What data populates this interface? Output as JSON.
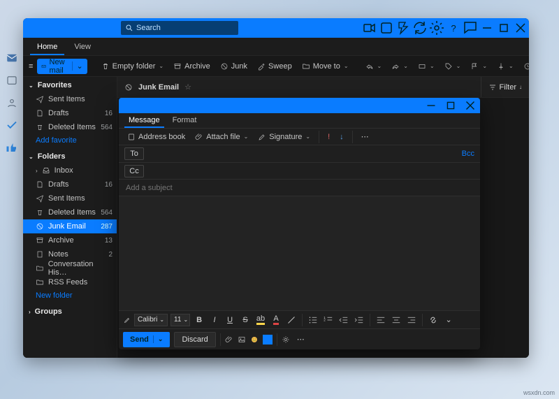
{
  "search": {
    "placeholder": "Search"
  },
  "tabs": {
    "home": "Home",
    "view": "View"
  },
  "toolbar": {
    "newmail": "New mail",
    "emptyfolder": "Empty folder",
    "archive": "Archive",
    "junk": "Junk",
    "sweep": "Sweep",
    "moveto": "Move to"
  },
  "sidebar": {
    "favorites": "Favorites",
    "fav_items": [
      {
        "label": "Sent Items",
        "count": ""
      },
      {
        "label": "Drafts",
        "count": "16"
      },
      {
        "label": "Deleted Items",
        "count": "564"
      }
    ],
    "add_favorite": "Add favorite",
    "folders": "Folders",
    "folder_items": [
      {
        "label": "Inbox",
        "count": ""
      },
      {
        "label": "Drafts",
        "count": "16"
      },
      {
        "label": "Sent Items",
        "count": ""
      },
      {
        "label": "Deleted Items",
        "count": "564"
      },
      {
        "label": "Junk Email",
        "count": "287"
      },
      {
        "label": "Archive",
        "count": "13"
      },
      {
        "label": "Notes",
        "count": "2"
      },
      {
        "label": "Conversation His…",
        "count": ""
      },
      {
        "label": "RSS Feeds",
        "count": ""
      }
    ],
    "new_folder": "New folder",
    "groups": "Groups"
  },
  "list": {
    "title": "Junk Email",
    "filter": "Filter"
  },
  "compose": {
    "tabs": {
      "message": "Message",
      "format": "Format"
    },
    "tools": {
      "addressbook": "Address book",
      "attach": "Attach file",
      "signature": "Signature"
    },
    "to": "To",
    "cc": "Cc",
    "bcc": "Bcc",
    "subject_placeholder": "Add a subject",
    "font": "Calibri",
    "size": "11",
    "send": "Send",
    "discard": "Discard"
  },
  "watermark": "wsxdn.com"
}
